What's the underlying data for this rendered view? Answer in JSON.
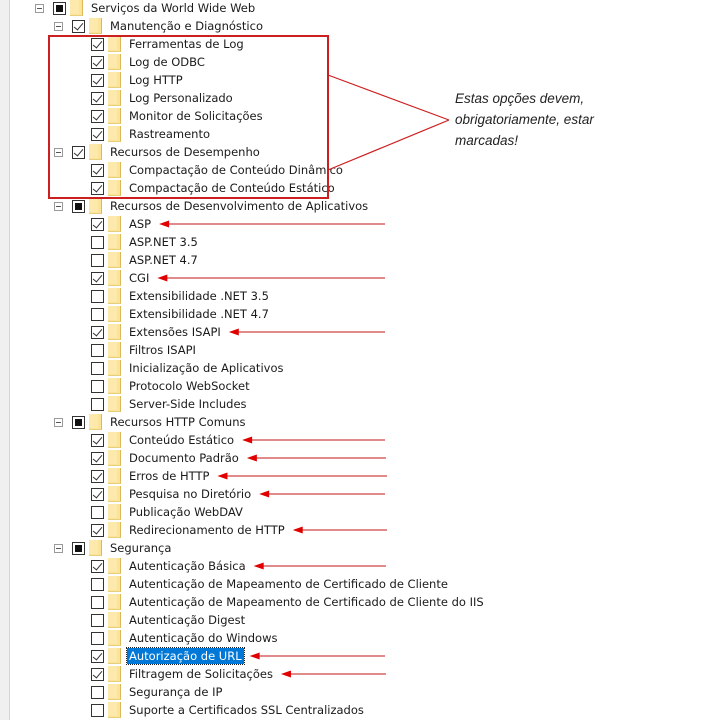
{
  "tree": {
    "root": {
      "label": "Serviços da World Wide Web",
      "state": "partial",
      "expanded": true
    },
    "groups": [
      {
        "label": "Manutenção e Diagnóstico",
        "state": "checked",
        "expanded": true,
        "items": [
          {
            "label": "Ferramentas de Log",
            "state": "checked"
          },
          {
            "label": "Log de ODBC",
            "state": "checked"
          },
          {
            "label": "Log HTTP",
            "state": "checked"
          },
          {
            "label": "Log Personalizado",
            "state": "checked"
          },
          {
            "label": "Monitor de Solicitações",
            "state": "checked"
          },
          {
            "label": "Rastreamento",
            "state": "checked"
          }
        ]
      },
      {
        "label": "Recursos de Desempenho",
        "state": "checked",
        "expanded": true,
        "items": [
          {
            "label": "Compactação de Conteúdo Dinâmico",
            "state": "checked"
          },
          {
            "label": "Compactação de Conteúdo Estático",
            "state": "checked"
          }
        ]
      },
      {
        "label": "Recursos de Desenvolvimento de Aplicativos",
        "state": "partial",
        "expanded": true,
        "items": [
          {
            "label": "ASP",
            "state": "checked",
            "arrow": true
          },
          {
            "label": "ASP.NET 3.5",
            "state": "unchecked"
          },
          {
            "label": "ASP.NET 4.7",
            "state": "unchecked"
          },
          {
            "label": "CGI",
            "state": "checked",
            "arrow": true
          },
          {
            "label": "Extensibilidade .NET 3.5",
            "state": "unchecked"
          },
          {
            "label": "Extensibilidade .NET 4.7",
            "state": "unchecked"
          },
          {
            "label": "Extensões ISAPI",
            "state": "checked",
            "arrow": true
          },
          {
            "label": "Filtros ISAPI",
            "state": "unchecked"
          },
          {
            "label": "Inicialização de Aplicativos",
            "state": "unchecked"
          },
          {
            "label": "Protocolo WebSocket",
            "state": "unchecked"
          },
          {
            "label": "Server-Side Includes",
            "state": "unchecked"
          }
        ]
      },
      {
        "label": "Recursos HTTP Comuns",
        "state": "partial",
        "expanded": true,
        "items": [
          {
            "label": "Conteúdo Estático",
            "state": "checked",
            "arrow": true
          },
          {
            "label": "Documento Padrão",
            "state": "checked",
            "arrow": true
          },
          {
            "label": "Erros de HTTP",
            "state": "checked",
            "arrow": true
          },
          {
            "label": "Pesquisa no Diretório",
            "state": "checked",
            "arrow": true
          },
          {
            "label": "Publicação WebDAV",
            "state": "unchecked"
          },
          {
            "label": "Redirecionamento de HTTP",
            "state": "checked",
            "arrow": true
          }
        ]
      },
      {
        "label": "Segurança",
        "state": "partial",
        "expanded": true,
        "items": [
          {
            "label": "Autenticação Básica",
            "state": "checked",
            "arrow": true
          },
          {
            "label": "Autenticação de Mapeamento de Certificado de Cliente",
            "state": "unchecked"
          },
          {
            "label": "Autenticação de Mapeamento de Certificado de Cliente do IIS",
            "state": "unchecked"
          },
          {
            "label": "Autenticação Digest",
            "state": "unchecked"
          },
          {
            "label": "Autenticação do Windows",
            "state": "unchecked"
          },
          {
            "label": "Autorização de URL",
            "state": "checked",
            "arrow": true,
            "selected": true
          },
          {
            "label": "Filtragem de Solicitações",
            "state": "checked",
            "arrow": true
          },
          {
            "label": "Segurança de IP",
            "state": "unchecked"
          },
          {
            "label": "Suporte a Certificados SSL Centralizados",
            "state": "unchecked"
          }
        ]
      }
    ]
  },
  "annotation": {
    "callout_text": "Estas opções devem, obrigatoriamente, estar marcadas!",
    "highlight_color": "#cc1f1f",
    "arrow_color": "#e08a8a",
    "arrowhead_color": "#e00000"
  },
  "colors": {
    "selection": "#0078d7",
    "folder": "#fbe39a"
  }
}
